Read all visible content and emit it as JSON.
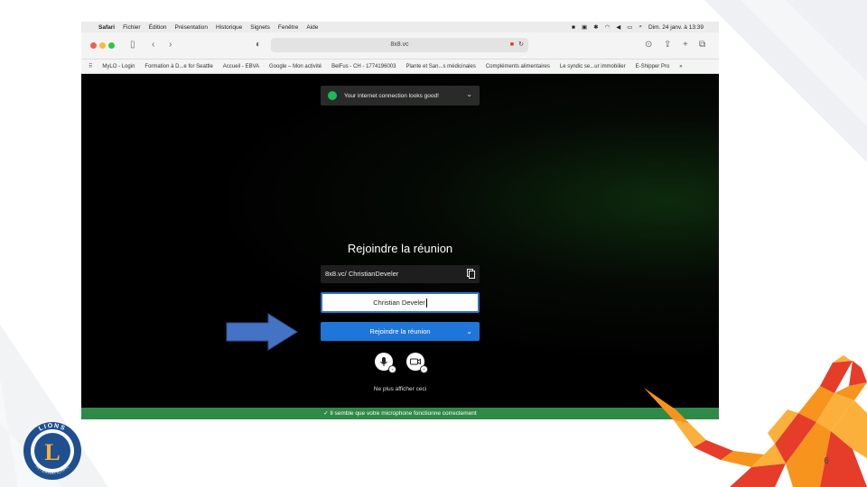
{
  "menubar": {
    "apple": "",
    "items": [
      "Safari",
      "Fichier",
      "Édition",
      "Présentation",
      "Historique",
      "Signets",
      "Fenêtre",
      "Aide"
    ],
    "datetime": "Dim. 24 janv. à 13:39"
  },
  "toolbar": {
    "url": "8x8.vc"
  },
  "bookmarks": [
    "MyLO - Login",
    "Formation à D...e for Seattle",
    "Accueil - EBVA",
    "Google – Mon activité",
    "BelFus - CH - 1774196003",
    "Plante et San...s médicinales",
    "Compléments alimentaires",
    "Le syndic se...ur immobilier",
    "E-Shipper Pro"
  ],
  "notification": {
    "text": "Your internet connection looks good!"
  },
  "join": {
    "title": "Rejoindre la réunion",
    "meeting_url": "8x8.vc/ ChristianDeveler",
    "name_value": "Christian Develer",
    "join_label": "Rejoindre la réunion",
    "dont_show": "Ne plus afficher ceci"
  },
  "status": {
    "text": "✓  Il semble que votre microphone fonctionne correctement"
  },
  "slide": {
    "page_number": "6",
    "logo_text": "LIONS",
    "logo_subtext": "INTERNATIONAL"
  },
  "colors": {
    "join_button": "#1f75d8",
    "status_bar": "#2f8a47",
    "arrow": "#4472c4",
    "lion_red": "#e53d2a",
    "lion_orange": "#f7941d",
    "lion_yellow": "#fbb03b",
    "logo_blue": "#1f4f8f"
  }
}
